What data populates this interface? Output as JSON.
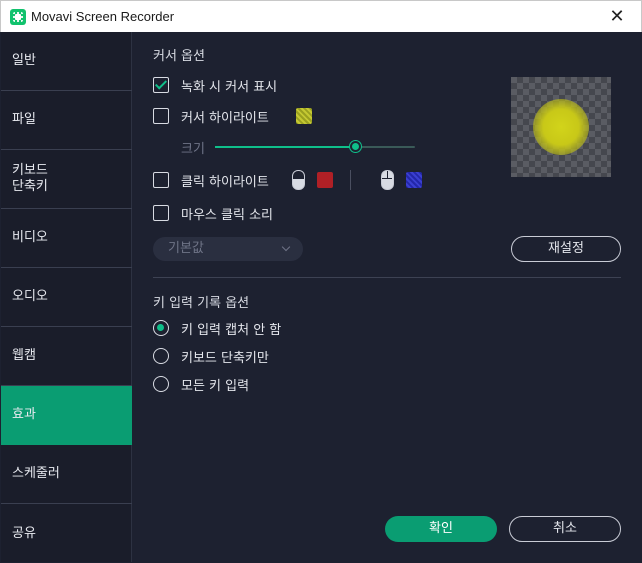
{
  "window": {
    "title": "Movavi Screen Recorder",
    "close_glyph": "✕"
  },
  "sidebar": {
    "items": [
      {
        "label": "일반"
      },
      {
        "label": "파일"
      },
      {
        "label": "키보드\n단축키"
      },
      {
        "label": "비디오"
      },
      {
        "label": "오디오"
      },
      {
        "label": "웹캠"
      },
      {
        "label": "효과",
        "active": true
      },
      {
        "label": "스케줄러"
      },
      {
        "label": "공유"
      }
    ]
  },
  "cursor_options": {
    "title": "커서 옵션",
    "show_cursor": {
      "label": "녹화 시 커서 표시",
      "checked": true
    },
    "highlight": {
      "label": "커서 하이라이트",
      "checked": false,
      "color": "#c4c832"
    },
    "size": {
      "label": "크기",
      "value_fraction": 0.71
    },
    "click_highlight": {
      "label": "클릭 하이라이트",
      "checked": false,
      "left_color": "#b02026",
      "right_color": "#2327a8"
    },
    "click_sound": {
      "label": "마우스 클릭 소리",
      "checked": false
    },
    "sound_preset": "기본값",
    "reset_label": "재설정"
  },
  "key_options": {
    "title": "키 입력 기록 옵션",
    "options": [
      {
        "label": "키 입력 캡처 안 함",
        "selected": true
      },
      {
        "label": "키보드 단축키만",
        "selected": false
      },
      {
        "label": "모든 키 입력",
        "selected": false
      }
    ]
  },
  "footer": {
    "ok_label": "확인",
    "cancel_label": "취소"
  },
  "colors": {
    "accent": "#0a9d72",
    "background": "#1d2130",
    "sidebar": "#1a1d2a"
  }
}
